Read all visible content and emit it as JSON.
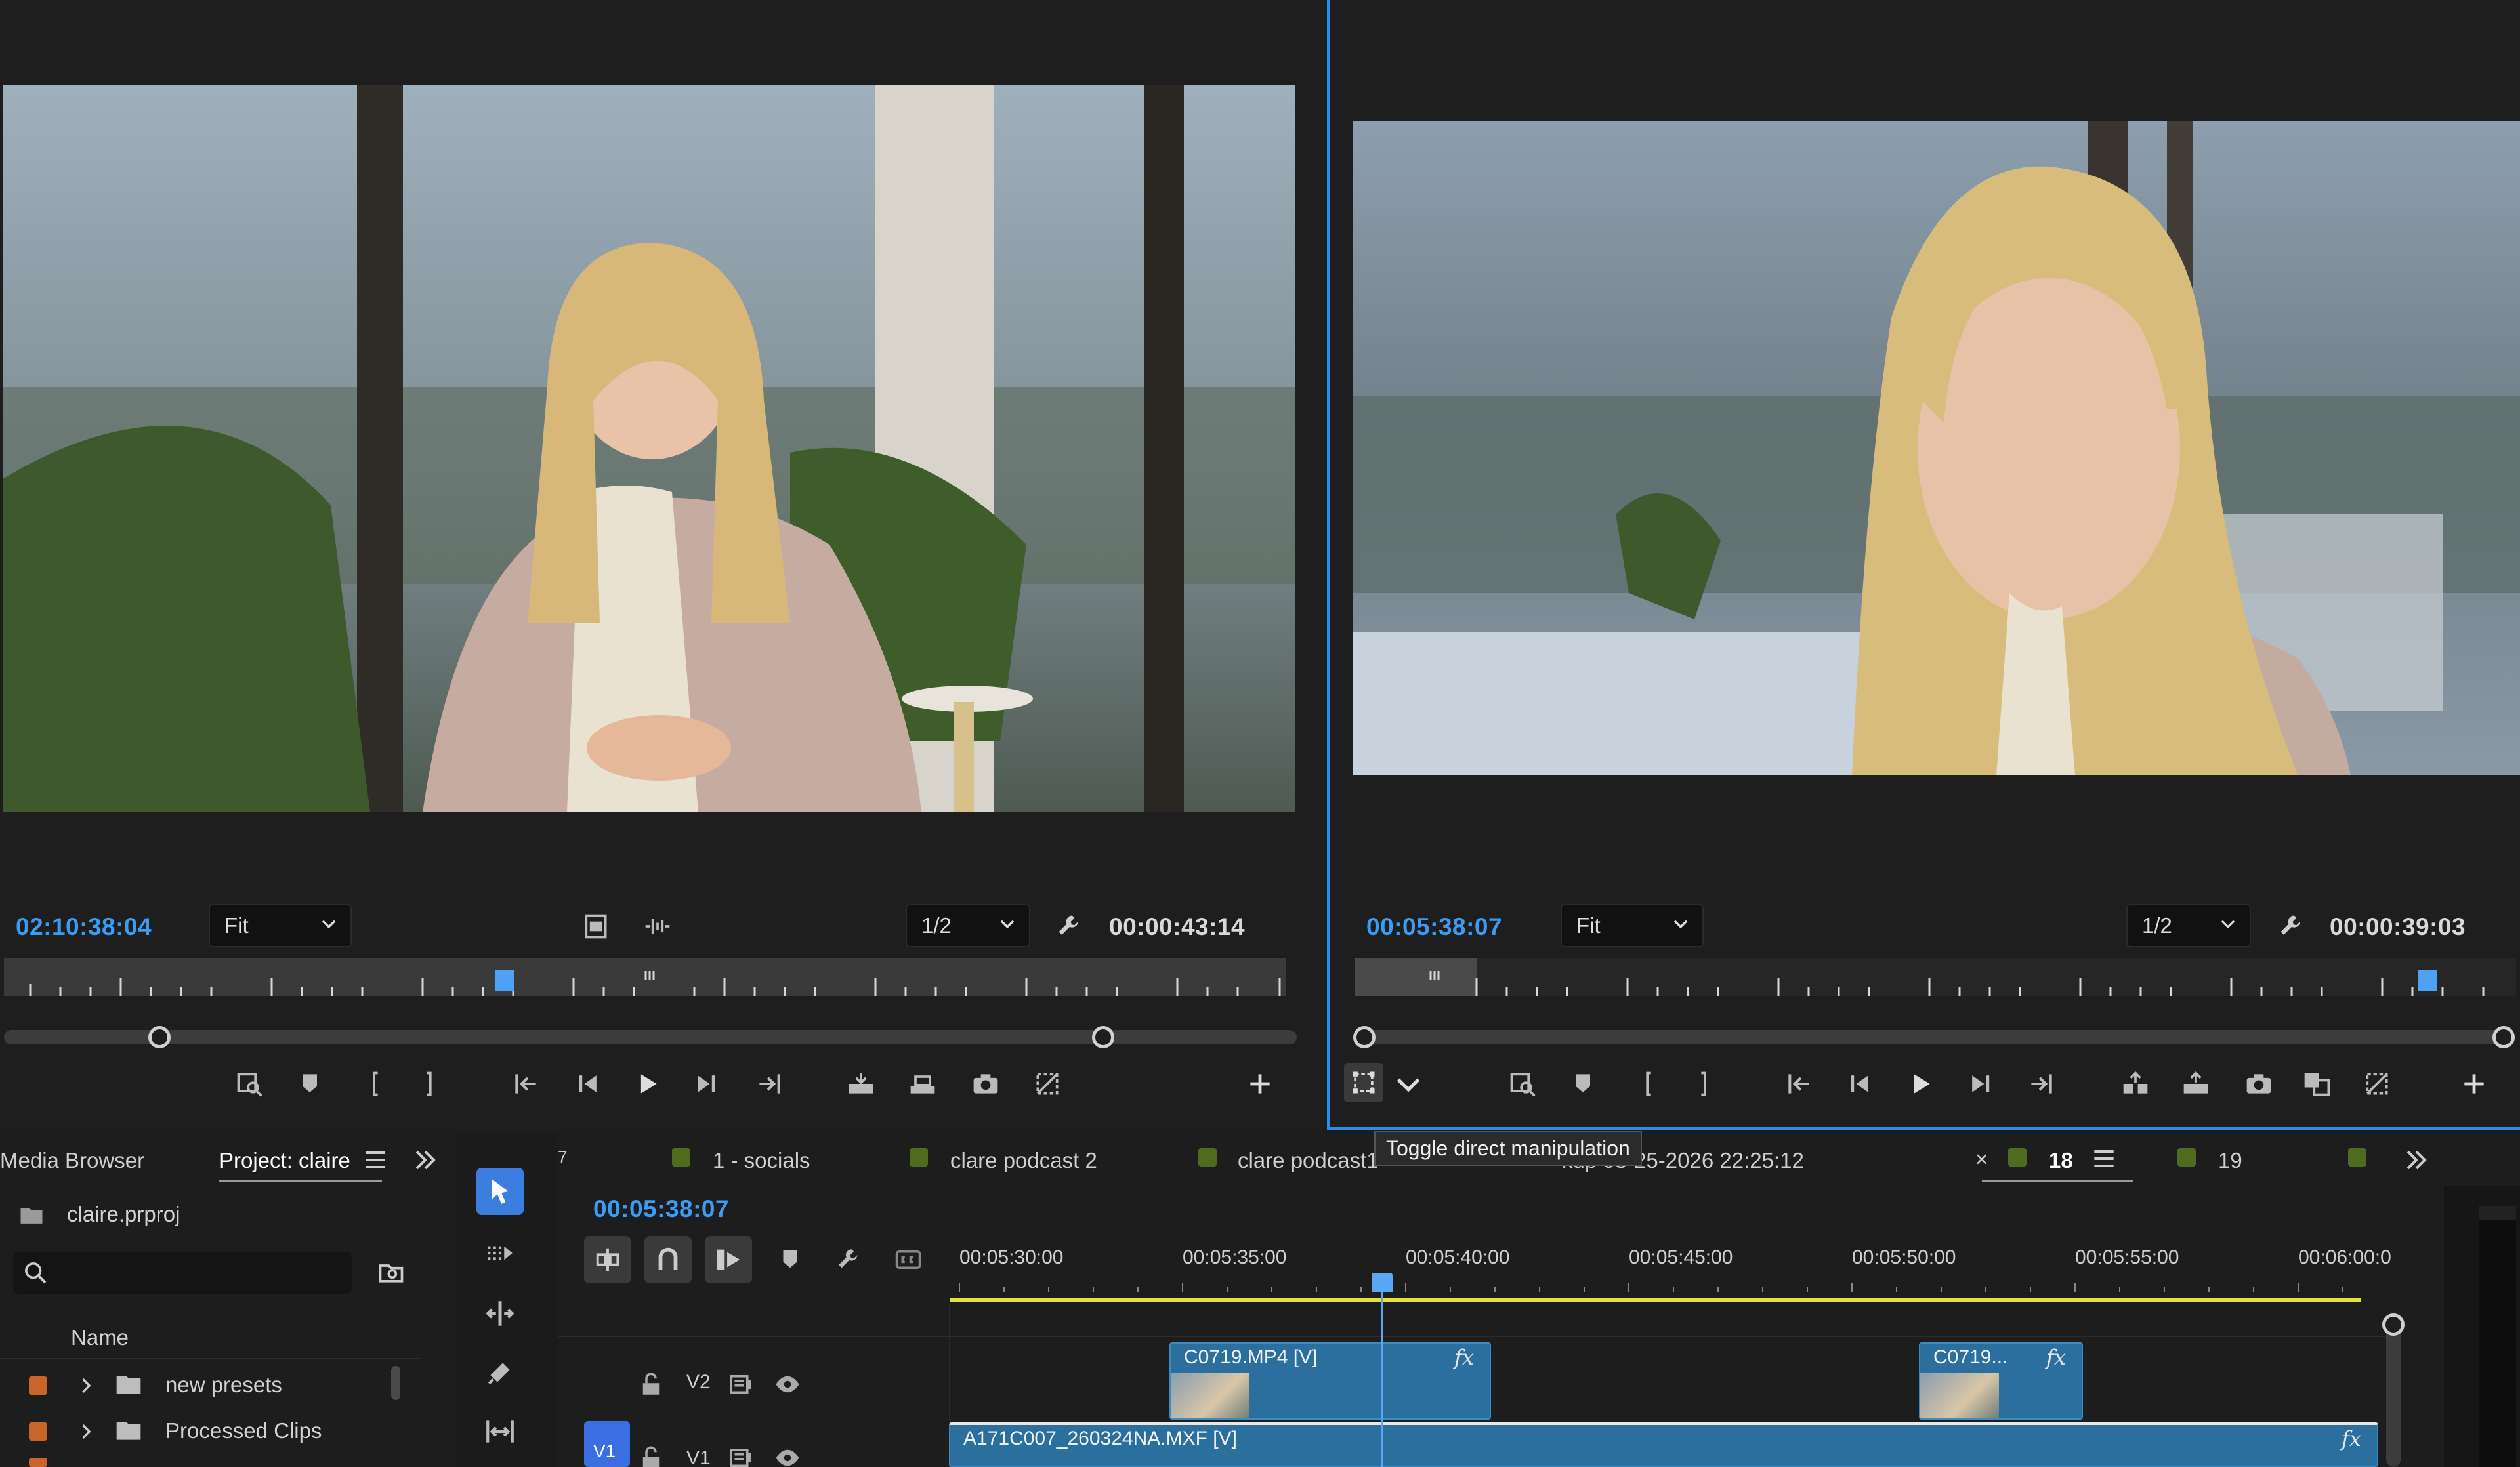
{
  "source_monitor": {
    "timecode_in": "02:10:38:04",
    "zoom": "Fit",
    "resolution": "1/2",
    "timecode_duration": "00:00:43:14"
  },
  "program_monitor": {
    "timecode_in": "00:05:38:07",
    "zoom": "Fit",
    "resolution": "1/2",
    "timecode_duration": "00:00:39:03",
    "tooltip": "Toggle direct manipulation"
  },
  "project_panel": {
    "tab_media_browser": "Media Browser",
    "tab_project": "Project: claire",
    "project_file": "claire.prproj",
    "search_placeholder": "",
    "column_name": "Name",
    "items": [
      {
        "label": "new presets",
        "color": "#c8652a"
      },
      {
        "label": "Processed Clips",
        "color": "#c8652a"
      }
    ]
  },
  "timeline": {
    "tabs": [
      {
        "label": "1 - socials",
        "color": "#4f6b1f"
      },
      {
        "label": "clare podcast 2",
        "color": "#4f6b1f"
      },
      {
        "label": "clare podcast1",
        "color": "#4f6b1f"
      },
      {
        "label": "kup 03-25-2026 22:25:12",
        "color": "#4f6b1f"
      },
      {
        "label": "18",
        "color": "#4f6b1f"
      },
      {
        "label": "19",
        "color": "#4f6b1f"
      }
    ],
    "tab_close": "×",
    "tab_partial_left": "7",
    "current_timecode": "00:05:38:07",
    "ruler_labels": [
      "00:05:30:00",
      "00:05:35:00",
      "00:05:40:00",
      "00:05:45:00",
      "00:05:50:00",
      "00:05:55:00",
      "00:06:00:0"
    ],
    "tracks": {
      "v2_label": "V2",
      "v1_label": "V1",
      "v1_target": "V1"
    },
    "clips": [
      {
        "name": "C0719.MP4 [V]",
        "fx": "fx"
      },
      {
        "name": "C0719...",
        "fx": "fx"
      },
      {
        "name": "A171C007_260324NA.MXF [V]",
        "fx": "fx"
      }
    ]
  }
}
